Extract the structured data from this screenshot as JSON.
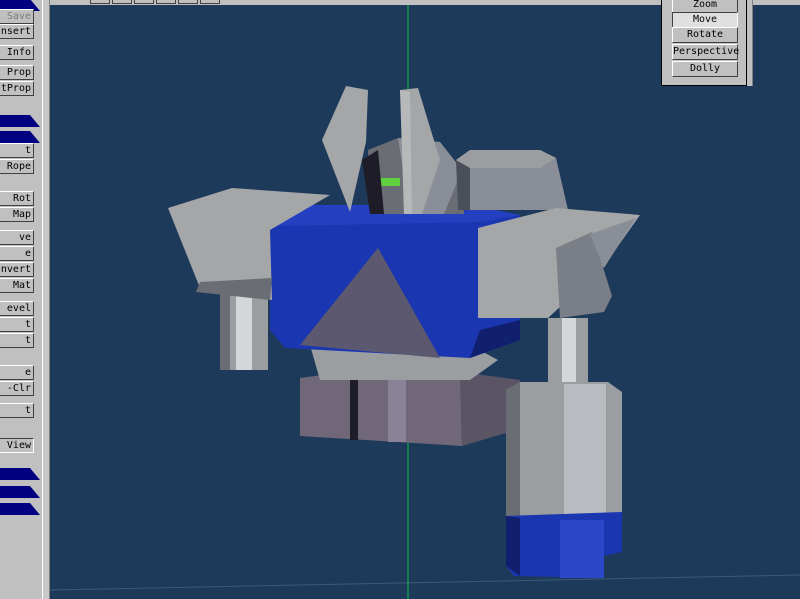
{
  "left_toolbar": {
    "buttons": [
      {
        "label": "Save",
        "disabled": true
      },
      {
        "label": "Insert",
        "disabled": false
      },
      {
        "label": "Info",
        "disabled": false
      },
      {
        "label": "Prop",
        "disabled": false
      },
      {
        "label": "tProp",
        "disabled": false
      },
      {
        "label": "t",
        "disabled": false
      },
      {
        "label": "Rope",
        "disabled": false
      },
      {
        "label": "Rot",
        "disabled": false
      },
      {
        "label": "Map",
        "disabled": false
      },
      {
        "label": "ve",
        "disabled": false
      },
      {
        "label": "e",
        "disabled": false
      },
      {
        "label": "nvert",
        "disabled": false
      },
      {
        "label": "Mat",
        "disabled": false
      },
      {
        "label": "evel",
        "disabled": false
      },
      {
        "label": "t",
        "disabled": false
      },
      {
        "label": "t",
        "disabled": false
      },
      {
        "label": "e",
        "disabled": false
      },
      {
        "label": "-Clr",
        "disabled": false
      },
      {
        "label": "t",
        "disabled": false
      },
      {
        "label": "View",
        "disabled": false
      }
    ],
    "banner_color": "#000080"
  },
  "camera_panel": {
    "buttons": [
      {
        "label": "Zoom",
        "active": false
      },
      {
        "label": "Move",
        "active": true
      },
      {
        "label": "Rotate",
        "active": false
      },
      {
        "label": "Perspective",
        "active": false
      },
      {
        "label": "Dolly",
        "active": false
      }
    ]
  },
  "viewport": {
    "background": "#1e3a5a",
    "axis_color": "#00c040",
    "model_colors": {
      "gray": "#9a9ea0",
      "dark_gray": "#6a6e74",
      "purple_gray": "#706878",
      "blue": "#1a36b0",
      "light": "#c8ccd0",
      "green": "#60d040"
    }
  }
}
